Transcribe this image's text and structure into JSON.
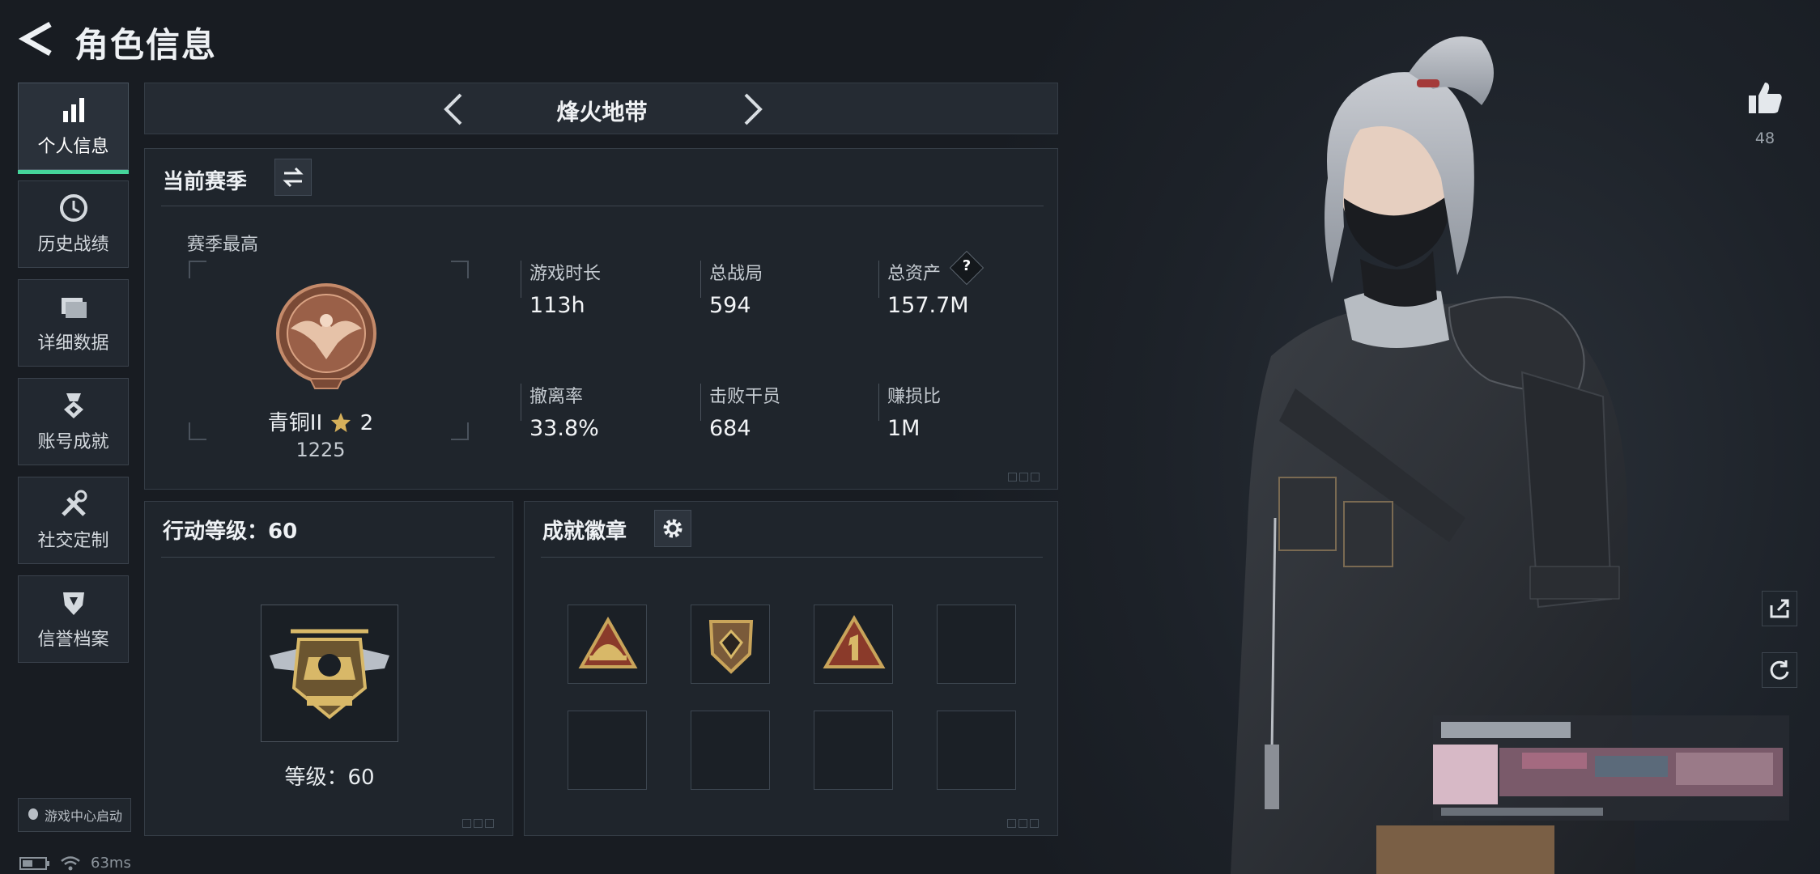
{
  "header": {
    "title": "角色信息"
  },
  "sidebar": {
    "items": [
      {
        "label": "个人信息",
        "icon": "bar-chart-icon",
        "active": true
      },
      {
        "label": "历史战绩",
        "icon": "clock-icon",
        "active": false
      },
      {
        "label": "详细数据",
        "icon": "folder-icon",
        "active": false
      },
      {
        "label": "账号成就",
        "icon": "medal-icon",
        "active": false
      },
      {
        "label": "社交定制",
        "icon": "tools-icon",
        "active": false
      },
      {
        "label": "信誉档案",
        "icon": "shield-icon",
        "active": false
      }
    ],
    "launch_label": "游戏中心启动"
  },
  "status": {
    "ping": "63ms"
  },
  "mode": {
    "title": "烽火地带"
  },
  "season": {
    "title": "当前赛季",
    "peak_label": "赛季最高",
    "rank_name": "青铜II",
    "rank_stars": "2",
    "rank_points": "1225",
    "stats": [
      {
        "label": "游戏时长",
        "value": "113h"
      },
      {
        "label": "总战局",
        "value": "594"
      },
      {
        "label": "总资产",
        "value": "157.7M",
        "help": "?"
      },
      {
        "label": "撤离率",
        "value": "33.8%"
      },
      {
        "label": "击败干员",
        "value": "684"
      },
      {
        "label": "赚损比",
        "value": "1M"
      }
    ]
  },
  "level": {
    "title": "行动等级：60",
    "caption": "等级：60"
  },
  "badges": {
    "title": "成就徽章"
  },
  "social": {
    "like_count": "48"
  },
  "colors": {
    "accent": "#45d49a",
    "bronze": "#a0654a",
    "gold": "#c9a45a"
  }
}
